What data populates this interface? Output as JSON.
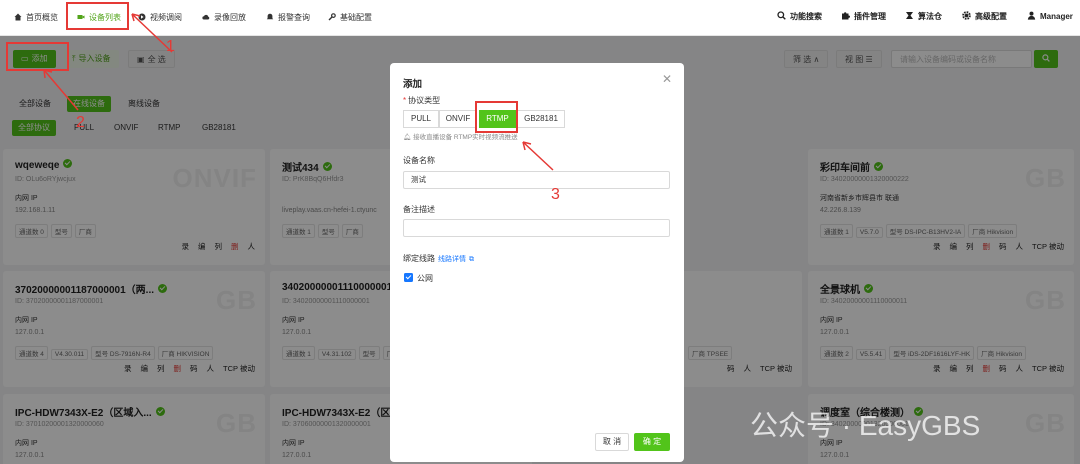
{
  "nav": {
    "items": [
      "首页概览",
      "设备列表",
      "视频调阅",
      "录像回放",
      "报警查询",
      "基础配置"
    ],
    "right": [
      "功能搜索",
      "插件管理",
      "算法仓",
      "高级配置",
      "Manager"
    ]
  },
  "toolbar": {
    "add": "添加",
    "import": "导入设备",
    "select_all": "全 选",
    "filter": "筛 选",
    "view": "视 图",
    "search_placeholder": "请输入设备编码或设备名称"
  },
  "tabs": {
    "status": [
      "全部设备",
      "在线设备",
      "离线设备"
    ],
    "protocol": [
      "全部协议",
      "PULL",
      "ONVIF",
      "RTMP",
      "GB28181"
    ]
  },
  "cards": [
    {
      "title": "wqeweqe",
      "id": "ID: OLu6oRYjwcjux",
      "net": "内网 IP",
      "ip": "192.168.1.11",
      "meta": [
        "通道数 0",
        "",
        "型号",
        "厂商"
      ],
      "wm": "ONVIF",
      "acts": [
        "录",
        "编",
        "列",
        "删",
        "人"
      ]
    },
    {
      "title": "测试434",
      "id": "ID: PrK8BqQ6Hfdr3",
      "net": "",
      "ip": "liveplay.vaas.cn-hefei-1.ctyunc",
      "meta": [
        "通道数 1",
        "",
        "型号",
        "厂商"
      ],
      "wm": "",
      "acts": []
    },
    {
      "title": "彩印车间前",
      "id": "ID: 34020000001320000222",
      "net": "河南省新乡市辉县市 联通",
      "ip": "42.226.8.139",
      "meta": [
        "通道数 1",
        "V5.7.0",
        "型号 DS-IPC-B13HV2-IA",
        "厂商 Hikvision"
      ],
      "wm": "GB",
      "acts": [
        "录",
        "编",
        "列",
        "删",
        "码",
        "人",
        "TCP 被动"
      ]
    },
    {
      "title": "37020000001187000001（两...",
      "id": "ID: 37020000001187000001",
      "net": "内网 IP",
      "ip": "127.0.0.1",
      "meta": [
        "通道数 4",
        "V4.30.011",
        "型号 DS-7916N-R4",
        "厂商 HIKVISION"
      ],
      "wm": "GB",
      "acts": [
        "录",
        "编",
        "列",
        "删",
        "码",
        "人",
        "TCP 被动"
      ]
    },
    {
      "title": "34020000001110000001",
      "id": "ID: 34020000001110000001",
      "net": "内网 IP",
      "ip": "127.0.0.1",
      "meta": [
        "通道数 1",
        "V4.31.102",
        "型号",
        "厂商"
      ],
      "wm": "",
      "acts": []
    },
    {
      "title": "",
      "id": "",
      "net": "",
      "ip": "",
      "meta": [
        "",
        "",
        "厂商 TPSEE"
      ],
      "wm": "",
      "acts": [
        "码",
        "人",
        "TCP 被动"
      ]
    },
    {
      "title": "全景球机",
      "id": "ID: 34020000001110000011",
      "net": "内网 IP",
      "ip": "127.0.0.1",
      "meta": [
        "通道数 2",
        "V5.5.41",
        "型号 iDS-2DF1616LYF-HK",
        "厂商 Hikvision"
      ],
      "wm": "GB",
      "acts": [
        "录",
        "编",
        "列",
        "删",
        "码",
        "人",
        "TCP 被动"
      ]
    },
    {
      "title": "IPC-HDW7343X-E2（区域入...",
      "id": "ID: 37010200001320000060",
      "net": "内网 IP",
      "ip": "127.0.0.1",
      "meta": [],
      "wm": "GB",
      "acts": []
    },
    {
      "title": "IPC-HDW7343X-E2（区",
      "id": "ID: 37060000001320000001",
      "net": "内网 IP",
      "ip": "127.0.0.1",
      "meta": [],
      "wm": "",
      "acts": []
    },
    {
      "title": "调度室（综合楼测）",
      "id": "ID: 34020000001320000001",
      "net": "内网 IP",
      "ip": "127.0.0.1",
      "meta": [],
      "wm": "GB",
      "acts": []
    }
  ],
  "modal": {
    "title": "添加",
    "protocol_label": "协议类型",
    "protocols": [
      "PULL",
      "ONVIF",
      "RTMP",
      "GB28181"
    ],
    "tip": "接收直播设备 RTMP实时视频流推送",
    "name_label": "设备名称",
    "name_value": "测试",
    "desc_label": "备注描述",
    "desc_value": "",
    "route_label": "绑定线路",
    "route_link": "线路详情",
    "public_net": "公网",
    "cancel": "取 消",
    "confirm": "确 定"
  },
  "annotations": [
    "1",
    "2",
    "3"
  ],
  "watermark": "公众号 · EasyGBS",
  "colors": {
    "accent": "#52c41a",
    "annotation": "#e53935",
    "link": "#1677ff"
  }
}
